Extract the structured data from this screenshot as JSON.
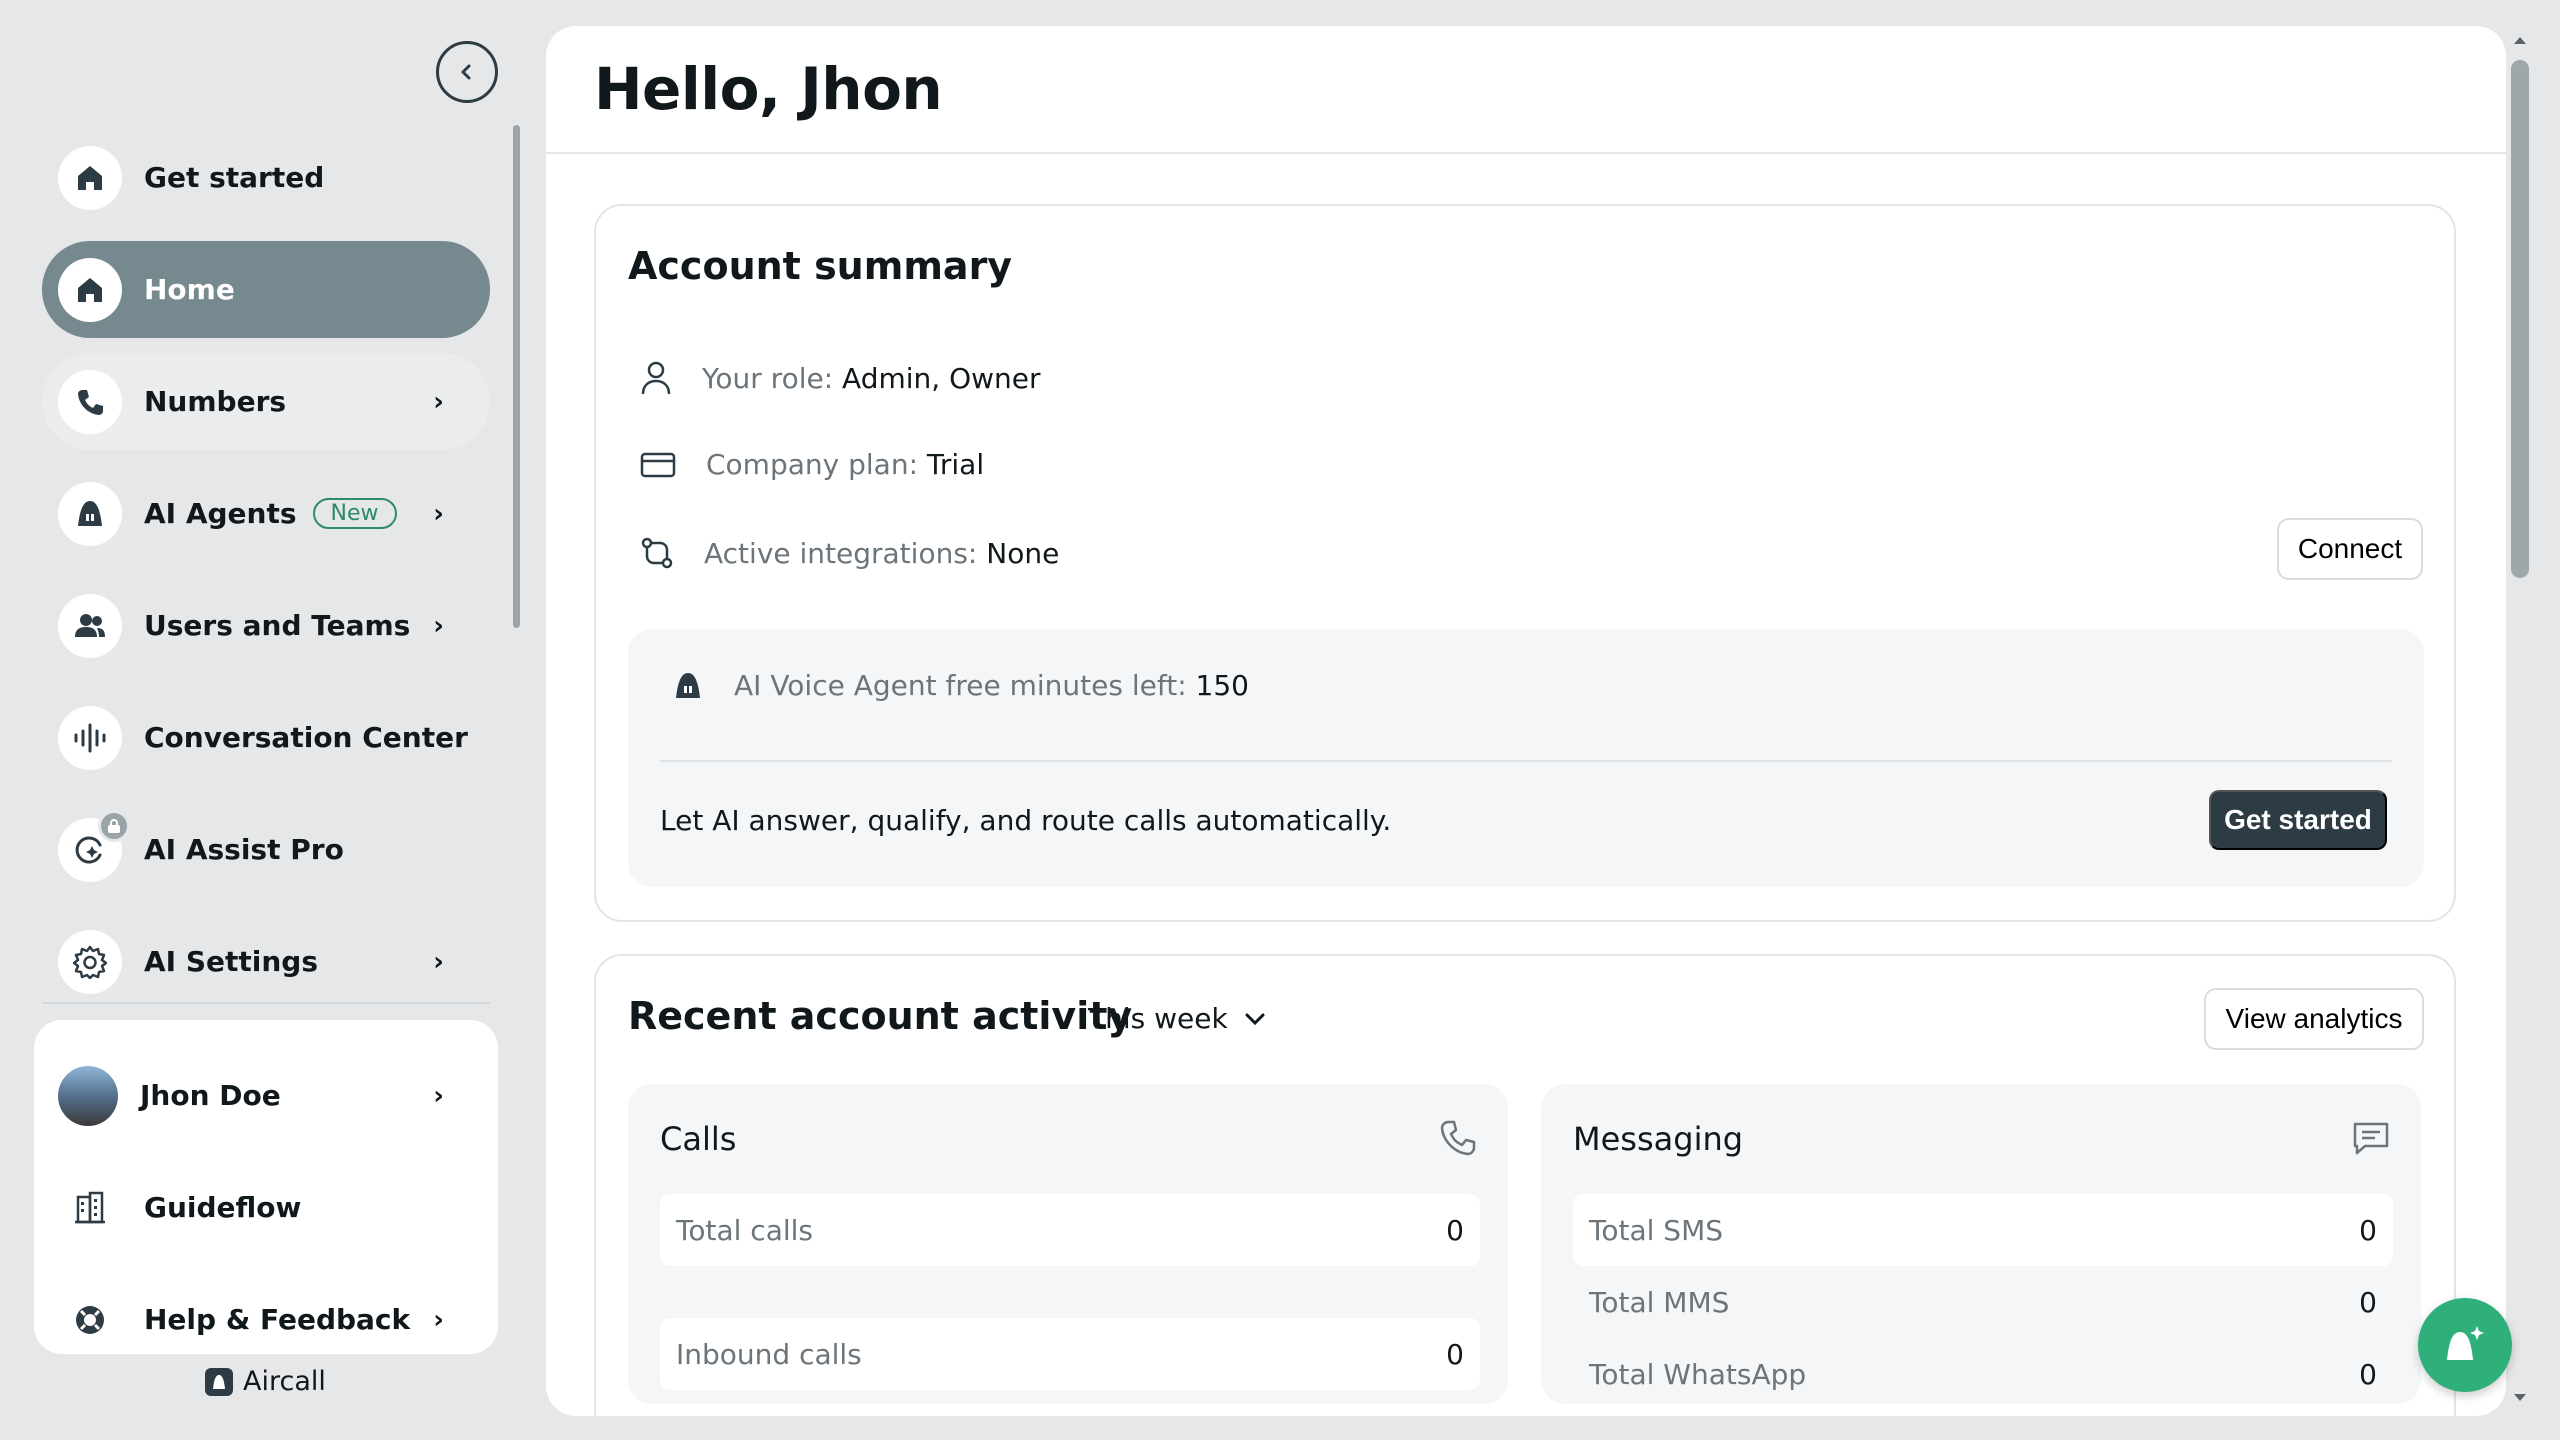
{
  "sidebar": {
    "items": [
      {
        "label": "Get started",
        "icon": "home-icon"
      },
      {
        "label": "Home",
        "icon": "home-icon"
      },
      {
        "label": "Numbers",
        "icon": "phone-icon"
      },
      {
        "label": "AI Agents",
        "icon": "ai-agent-icon",
        "badge": "New"
      },
      {
        "label": "Users and Teams",
        "icon": "users-icon"
      },
      {
        "label": "Conversation Center",
        "icon": "waveform-icon"
      },
      {
        "label": "AI Assist Pro",
        "icon": "ai-assist-icon"
      },
      {
        "label": "AI Settings",
        "icon": "gear-icon"
      }
    ],
    "user": {
      "name": "Jhon Doe",
      "guideflow": "Guideflow",
      "help": "Help & Feedback"
    },
    "brand": "Aircall"
  },
  "header": {
    "title": "Hello, Jhon"
  },
  "account_summary": {
    "title": "Account summary",
    "role_label": "Your role:",
    "role_value": "Admin, Owner",
    "plan_label": "Company plan:",
    "plan_value": "Trial",
    "integrations_label": "Active integrations:",
    "integrations_value": "None",
    "connect_label": "Connect",
    "ai_minutes_label": "AI Voice Agent free minutes left:",
    "ai_minutes_value": "150",
    "ai_promo": "Let AI answer, qualify, and route calls automatically.",
    "get_started_label": "Get started"
  },
  "activity": {
    "title": "Recent account activity",
    "period": "This week",
    "view_analytics": "View analytics",
    "calls": {
      "title": "Calls",
      "total_label": "Total calls",
      "total_value": "0",
      "inbound_label": "Inbound calls",
      "inbound_value": "0"
    },
    "messaging": {
      "title": "Messaging",
      "sms_label": "Total SMS",
      "sms_value": "0",
      "mms_label": "Total MMS",
      "mms_value": "0",
      "whatsapp_label": "Total WhatsApp",
      "whatsapp_value": "0"
    }
  },
  "colors": {
    "active_nav": "#76898e",
    "primary_dark": "#2d3b44",
    "accent_green": "#2fb07a",
    "badge_green": "#2e8a6c"
  }
}
